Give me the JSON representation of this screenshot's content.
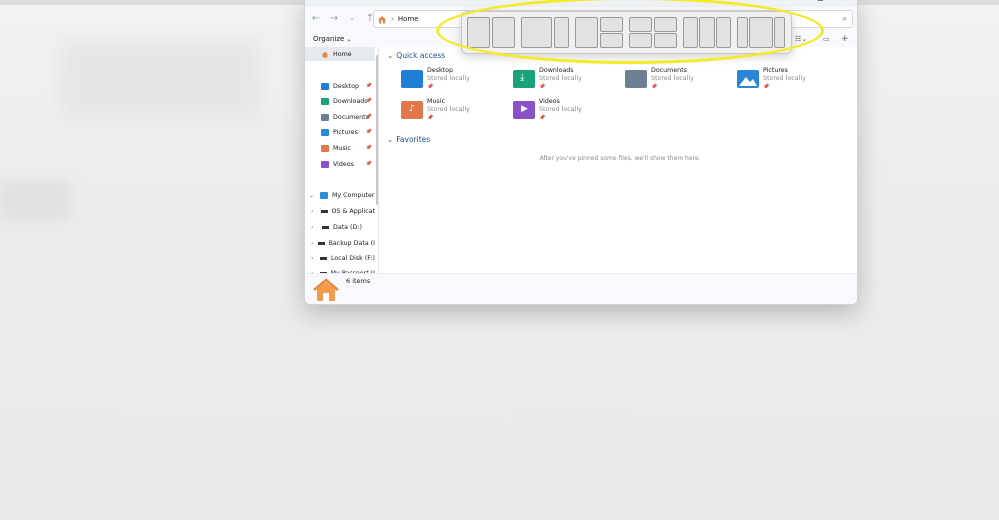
{
  "address": {
    "crumb": "Home"
  },
  "toolbar": {
    "organize_label": "Organize"
  },
  "sidebar": {
    "pinned": [
      {
        "label": "Home",
        "icon": "home-icon"
      },
      {
        "label": "Desktop",
        "icon": "desktop-folder-icon"
      },
      {
        "label": "Downloads",
        "icon": "downloads-folder-icon"
      },
      {
        "label": "Documents",
        "icon": "documents-folder-icon"
      },
      {
        "label": "Pictures",
        "icon": "pictures-folder-icon"
      },
      {
        "label": "Music",
        "icon": "music-folder-icon"
      },
      {
        "label": "Videos",
        "icon": "videos-folder-icon"
      }
    ],
    "computer": {
      "label": "My Computer"
    },
    "drives": [
      {
        "label": "OS & Applicat"
      },
      {
        "label": "Data (D:)"
      },
      {
        "label": "Backup Data (I"
      },
      {
        "label": "Local Disk (F:)"
      },
      {
        "label": "My Passport (I"
      }
    ]
  },
  "main": {
    "quick_access_title": "Quick access",
    "favorites_title": "Favorites",
    "favorites_empty": "After you've pinned some files, we'll show them here.",
    "tiles": [
      {
        "name": "Desktop",
        "sub": "Stored locally",
        "icon": "desktop-folder-icon",
        "color": "#1f7fd6"
      },
      {
        "name": "Downloads",
        "sub": "Stored locally",
        "icon": "downloads-folder-icon",
        "color": "#1aa37a"
      },
      {
        "name": "Documents",
        "sub": "Stored locally",
        "icon": "documents-folder-icon",
        "color": "#6d7f93"
      },
      {
        "name": "Pictures",
        "sub": "Stored locally",
        "icon": "pictures-folder-icon",
        "color": "#2a86d9"
      },
      {
        "name": "Music",
        "sub": "Stored locally",
        "icon": "music-folder-icon",
        "color": "#e0784a"
      },
      {
        "name": "Videos",
        "sub": "Stored locally",
        "icon": "videos-folder-icon",
        "color": "#8a52c9"
      }
    ]
  },
  "status": {
    "item_count": "6 items"
  },
  "colors": {
    "accent": "#1f4e96",
    "highlight_ring": "#f4ea28"
  }
}
